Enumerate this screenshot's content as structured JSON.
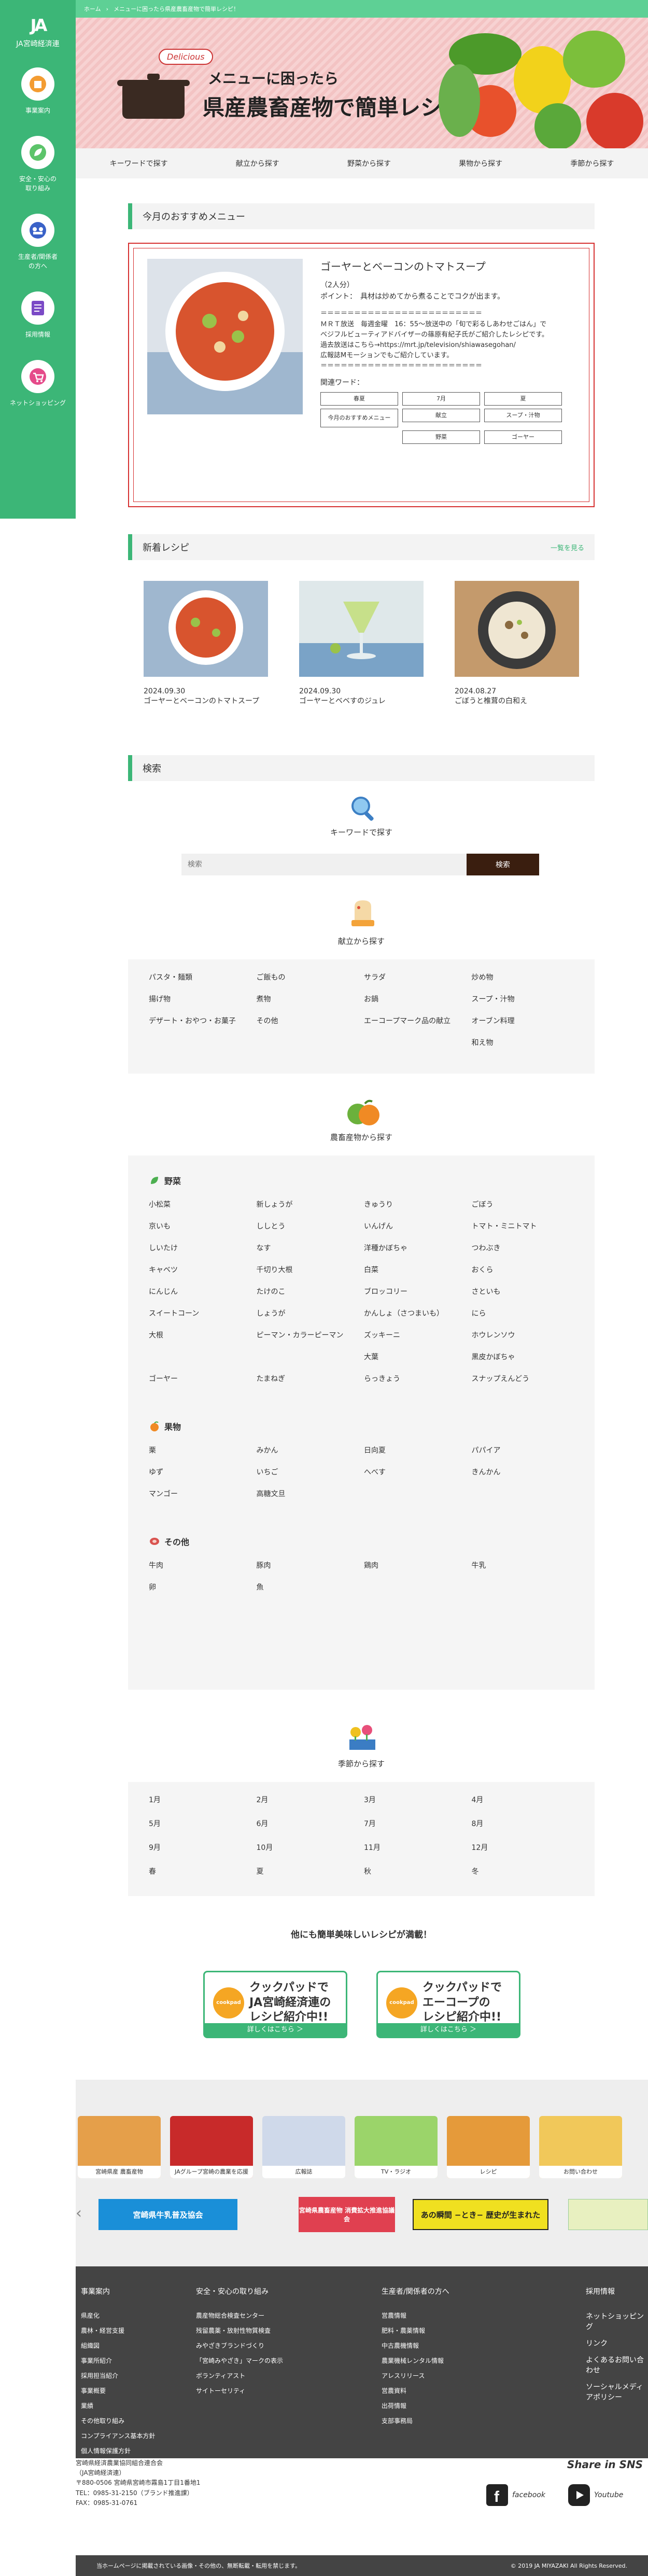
{
  "breadcrumb": [
    "ホーム",
    "メニューに困ったら県産農畜産物で簡単レシピ！"
  ],
  "site": {
    "logo_mark": "JA",
    "logo_text": "JA宮崎経済連"
  },
  "sidebar": [
    {
      "label": "事業案内"
    },
    {
      "label": "安全・安心の\n取り組み"
    },
    {
      "label": "生産者/関係者\nの方へ"
    },
    {
      "label": "採用情報"
    },
    {
      "label": "ネットショッピング"
    }
  ],
  "banner": {
    "tag": "Delicious",
    "line1": "メニューに困ったら",
    "line2": "県産農畜産物で簡単レシピ！"
  },
  "catnav": [
    "キーワードで探す",
    "献立から探す",
    "野菜から探す",
    "果物から探す",
    "季節から探す"
  ],
  "recommend": {
    "heading": "今月のおすすめメニュー",
    "title": "ゴーヤーとベーコンのトマトスープ",
    "servings": "（2人分）",
    "point": "ポイント：　具材は炒めてから煮ることでコクが出ます。",
    "body": "＝＝＝＝＝＝＝＝＝＝＝＝＝＝＝＝＝＝＝＝＝＝＝＝\nＭＲＴ放送　毎週金曜　16：55〜放送中の「旬で彩るしあわせごはん」で\nベジフルビューティアドバイザーの篠原有紀子氏がご紹介したレシピです。\n過去放送はこちら→https://mrt.jp/television/shiawasegohan/\n広報誌Mモーションでもご紹介しています。\n＝＝＝＝＝＝＝＝＝＝＝＝＝＝＝＝＝＝＝＝＝＝＝＝",
    "tags_label": "関連ワード：",
    "tags": [
      "春夏",
      "7月",
      "夏",
      "今月のおすすめメニュー",
      "献立",
      "スープ・汁物",
      "",
      "野菜",
      "ゴーヤー"
    ]
  },
  "new_recipes": {
    "heading": "新着レシピ",
    "more": "一覧を見る",
    "items": [
      {
        "date": "2024.09.30",
        "title": "ゴーヤーとベーコンのトマトスープ"
      },
      {
        "date": "2024.09.30",
        "title": "ゴーヤーとベベすのジュレ"
      },
      {
        "date": "2024.08.27",
        "title": "ごぼうと椎茸の白和え"
      }
    ]
  },
  "search": {
    "heading": "検索",
    "keyword_title": "キーワードで探す",
    "placeholder": "検索",
    "button": "検索"
  },
  "menu_search": {
    "title": "献立から探す",
    "items": [
      "パスタ・麺類",
      "ご飯もの",
      "サラダ",
      "炒め物",
      "揚げ物",
      "煮物",
      "お鍋",
      "スープ・汁物",
      "デザート・おやつ・お菓子",
      "その他",
      "エーコープマーク品の献立",
      "オーブン料理",
      "",
      "",
      "",
      "和え物"
    ]
  },
  "produce": {
    "title": "農畜産物から探す",
    "vegetables_label": "野菜",
    "vegetables": [
      "小松菜",
      "新しょうが",
      "きゅうり",
      "ごぼう",
      "京いも",
      "ししとう",
      "いんげん",
      "トマト・ミニトマト",
      "しいたけ",
      "なす",
      "洋種かぼちゃ",
      "つわぶき",
      "キャベツ",
      "千切り大根",
      "白菜",
      "おくら",
      "にんじん",
      "たけのこ",
      "ブロッコリー",
      "さといも",
      "スイートコーン",
      "しょうが",
      "かんしょ（さつまいも）",
      "にら",
      "大根",
      "ピーマン・カラーピーマン",
      "ズッキーニ",
      "ホウレンソウ",
      "",
      "",
      "大葉",
      "黒皮かぼちゃ",
      "ゴーヤー",
      "たまねぎ",
      "らっきょう",
      "スナップえんどう"
    ],
    "fruits_label": "果物",
    "fruits": [
      "栗",
      "みかん",
      "日向夏",
      "パパイア",
      "ゆず",
      "いちご",
      "へべす",
      "きんかん",
      "マンゴー",
      "高糖文旦"
    ],
    "others_label": "その他",
    "others": [
      "牛肉",
      "豚肉",
      "鶏肉",
      "牛乳",
      "卵",
      "魚"
    ]
  },
  "season": {
    "title": "季節から探す",
    "items": [
      "1月",
      "2月",
      "3月",
      "4月",
      "5月",
      "6月",
      "7月",
      "8月",
      "9月",
      "10月",
      "11月",
      "12月",
      "春",
      "夏",
      "秋",
      "冬"
    ]
  },
  "cookpad": {
    "heading": "他にも簡単美味しいレシピが満載！",
    "logo": "cookpad",
    "cards": [
      {
        "text": "クックパッドで\nJA宮崎経済連の\nレシピ紹介中!!",
        "link": "詳しくはこちら ＞"
      },
      {
        "text": "クックパッドで\nエーコープの\nレシピ紹介中!!",
        "link": "詳しくはこちら ＞"
      }
    ]
  },
  "banners": [
    {
      "label": "宮崎県産 農畜産物"
    },
    {
      "label": "JAグループ宮崎の農業を応援"
    },
    {
      "label": "広報誌"
    },
    {
      "label": "TV・ラジオ"
    },
    {
      "label": "レシピ"
    },
    {
      "label": "お問い合わせ"
    }
  ],
  "wide_banners": [
    {
      "label": "宮崎県牛乳普及協会",
      "color": "#1a8fd8"
    },
    {
      "label": "宮崎県農畜産物 消費拡大推進協議会",
      "color": "#e04050"
    },
    {
      "label": "あの瞬間 −とき− 歴史が生まれた",
      "color": "#f0e020"
    }
  ],
  "footer": {
    "cols": [
      {
        "title": "事業案内",
        "items": [
          "県産化",
          "農林・経営支援",
          "組織図",
          "事業所紹介",
          "採用担当紹介",
          "事業概要",
          "業績",
          "その他取り組み",
          "コンプライアンス基本方針",
          "個人情報保護方針"
        ]
      },
      {
        "title": "安全・安心の取り組み",
        "items": [
          "農産物総合検査センター",
          "残留農薬・放射性物質検査",
          "みやざきブランドづくり",
          "「宮崎みやざき」マークの表示",
          "ボランティアスト",
          "サイトーセリティ"
        ]
      },
      {
        "title": "生産者/関係者の方へ",
        "items": [
          "営農情報",
          "肥料・農薬情報",
          "中古農機情報",
          "農業機械レンタル情報",
          "アレスリリース",
          "営農資料",
          "出荷情報",
          "支部事務局"
        ]
      },
      {
        "title": "採用情報",
        "items": [
          "ネットショッピング",
          "リンク",
          "よくあるお問い合わせ",
          "ソーシャルメディアポリシー"
        ]
      }
    ],
    "corp": "宮崎県経済農業協同組合連合会\n（JA宮崎経済連）\n〒880-0506 宮崎県宮崎市霧島1丁目1番地1\nTEL：0985-31-2150（ブランド推進課）\nFAX：0985-31-0761",
    "sns_title": "Share in SNS",
    "facebook": "facebook",
    "youtube": "Youtube",
    "notice": "当ホームページに掲載されている画像・その他の、無断転載・転用を禁じます。",
    "copyright": "© 2019 JA MIYAZAKI All Rights Reserved."
  }
}
